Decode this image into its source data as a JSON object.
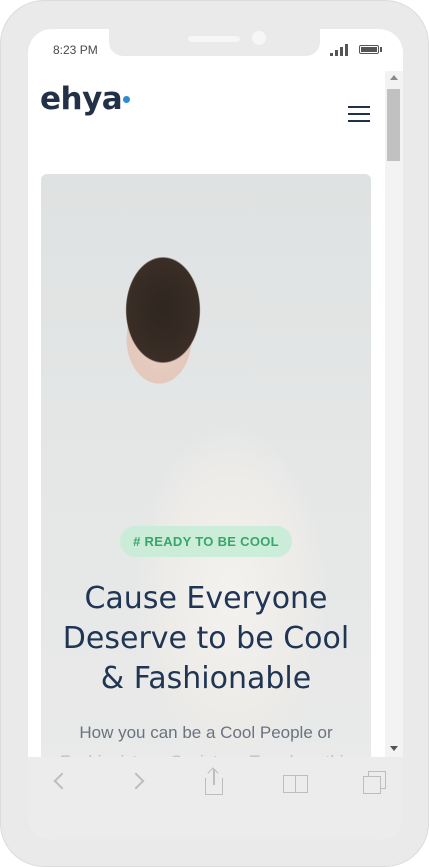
{
  "status_bar": {
    "time": "8:23 PM"
  },
  "header": {
    "logo": "ehya",
    "menu_icon": "hamburger-icon",
    "logo_dot_color": "#2a8bd7"
  },
  "hero": {
    "tag": "# READY TO BE COOL",
    "headline_lines": [
      "Cause Everyone",
      "Deserve to be Cool",
      "& Fashionable"
    ],
    "subtitle": "How you can be a Cool People or",
    "subtitle_partial": "Fashionista ... Society ... Trends ... this",
    "image_alt": "woman in white outfit"
  },
  "toolbar": {
    "back_icon": "chevron-left-icon",
    "forward_icon": "chevron-right-icon",
    "share_icon": "share-icon",
    "bookmarks_icon": "book-icon",
    "tabs_icon": "tabs-icon"
  },
  "colors": {
    "brand_dark": "#233148",
    "tag_green": "#3aa56b",
    "headline": "#1f3553"
  }
}
